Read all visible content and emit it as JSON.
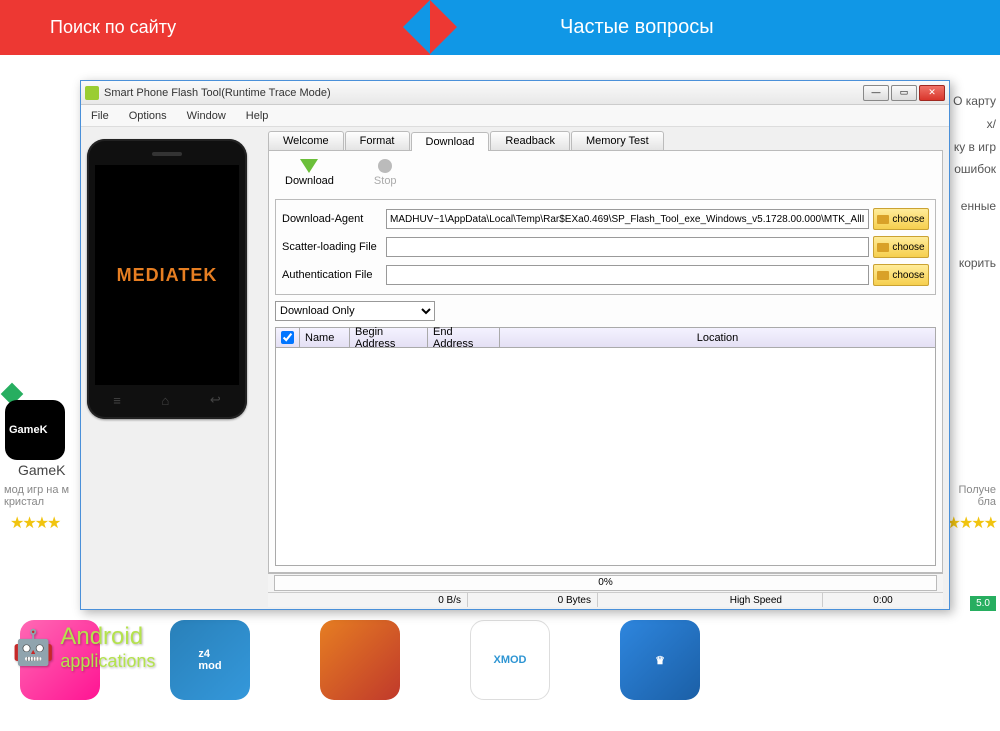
{
  "bg": {
    "search_label": "Поиск по сайту",
    "faq_label": "Частые вопросы",
    "right_texts": [
      "O карту",
      "x/",
      "ку в игр",
      "ошибок",
      "енные",
      "корить"
    ],
    "gamekiller_tile": "GameK",
    "gamekiller_label": "GameK",
    "sub_left": "мод игр на м\nкристал",
    "sub_right": "Получе\nбла",
    "stars": "★★★★",
    "green_badge": "5.0",
    "android_line1": "Android",
    "android_line2": "applications"
  },
  "window": {
    "title": "Smart Phone Flash Tool(Runtime Trace Mode)",
    "menu": {
      "file": "File",
      "options": "Options",
      "window": "Window",
      "help": "Help"
    },
    "tabs": {
      "welcome": "Welcome",
      "format": "Format",
      "download": "Download",
      "readback": "Readback",
      "memory": "Memory Test"
    },
    "toolbar": {
      "download": "Download",
      "stop": "Stop"
    },
    "form": {
      "agent_label": "Download-Agent",
      "agent_value": "MADHUV~1\\AppData\\Local\\Temp\\Rar$EXa0.469\\SP_Flash_Tool_exe_Windows_v5.1728.00.000\\MTK_AllInOne_DA.bin",
      "scatter_label": "Scatter-loading File",
      "scatter_value": "",
      "auth_label": "Authentication File",
      "auth_value": "",
      "choose": "choose",
      "download_only": "Download Only"
    },
    "table": {
      "name": "Name",
      "begin": "Begin Address",
      "end": "End Address",
      "location": "Location"
    },
    "status": {
      "percent": "0%",
      "speed": "0 B/s",
      "bytes": "0 Bytes",
      "mode": "High Speed",
      "time": "0:00"
    }
  },
  "phone": {
    "brand": "MEDIATEK"
  }
}
